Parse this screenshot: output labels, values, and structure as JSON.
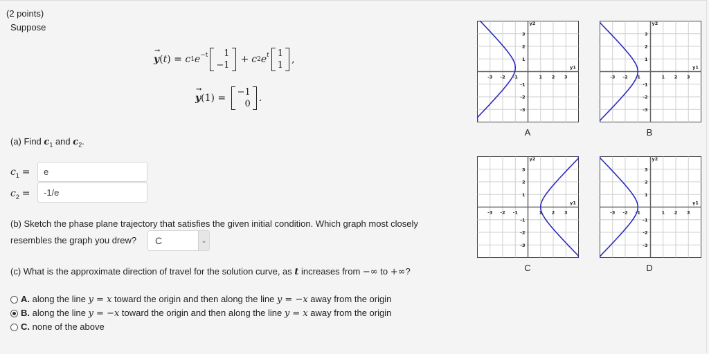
{
  "problem": {
    "points": "(2 points)",
    "intro": "Suppose",
    "equation1": {
      "lhs": "y(t) =",
      "term1_coef": "c",
      "term1_sub": "1",
      "term1_exp": "e",
      "term1_pow": "−t",
      "vec1": [
        "1",
        "−1"
      ],
      "plus": "+",
      "term2_coef": "c",
      "term2_sub": "2",
      "term2_exp": "e",
      "term2_pow": "t",
      "vec2": [
        "1",
        "1"
      ],
      "trail": ","
    },
    "equation2": {
      "lhs": "y(1) =",
      "vec": [
        "−1",
        "0"
      ],
      "trail": "."
    }
  },
  "part_a": {
    "prompt_prefix": "(a) Find ",
    "c1_label": "c",
    "and": " and ",
    "c2_label": "c",
    "sub1": "1",
    "sub2": "2",
    "period": ".",
    "eq_sign": "=",
    "c1_value": "e",
    "c2_value": "-1/e"
  },
  "part_b": {
    "line1": "(b) Sketch the phase plane trajectory that satisfies the given initial condition. Which graph most closely",
    "line2": "resembles the graph you drew?",
    "selected": "C",
    "arrow": "⌄"
  },
  "part_c": {
    "prompt_prefix": "(c) What is the approximate direction of travel for the solution curve, as ",
    "t": "t",
    "prompt_mid": " increases from ",
    "neg_inf": "−∞",
    "to": " to ",
    "pos_inf": "+∞",
    "q": "?",
    "options": [
      {
        "letter": "A.",
        "text_pre": " along the line ",
        "m1": "y = x",
        "text_mid": " toward the origin and then along the line ",
        "m2": "y = −x",
        "text_post": " away from the origin",
        "checked": false
      },
      {
        "letter": "B.",
        "text_pre": " along the line ",
        "m1": "y = −x",
        "text_mid": " toward the origin and then along the line ",
        "m2": "y = x",
        "text_post": " away from the origin",
        "checked": true
      },
      {
        "letter": "C.",
        "text_pre": " none of the above",
        "m1": "",
        "text_mid": "",
        "m2": "",
        "text_post": "",
        "checked": false
      }
    ]
  },
  "graphs": {
    "axis_x_label": "y1",
    "axis_y_label": "y2",
    "range": [
      -4,
      4
    ],
    "ticks": [
      "-3",
      "-2",
      "-1",
      "1",
      "2",
      "3"
    ],
    "curve_color": "#2b2bbf",
    "items": [
      {
        "label": "A",
        "vertex": [
          -1,
          0.3
        ],
        "opens": "left",
        "tilt": 0.3
      },
      {
        "label": "B",
        "vertex": [
          -1,
          0
        ],
        "opens": "left",
        "tilt": 0
      },
      {
        "label": "C",
        "vertex": [
          1,
          0
        ],
        "opens": "right",
        "tilt": 0
      },
      {
        "label": "D",
        "vertex": [
          -1,
          0
        ],
        "opens": "left",
        "tilt": 0.15
      }
    ]
  }
}
